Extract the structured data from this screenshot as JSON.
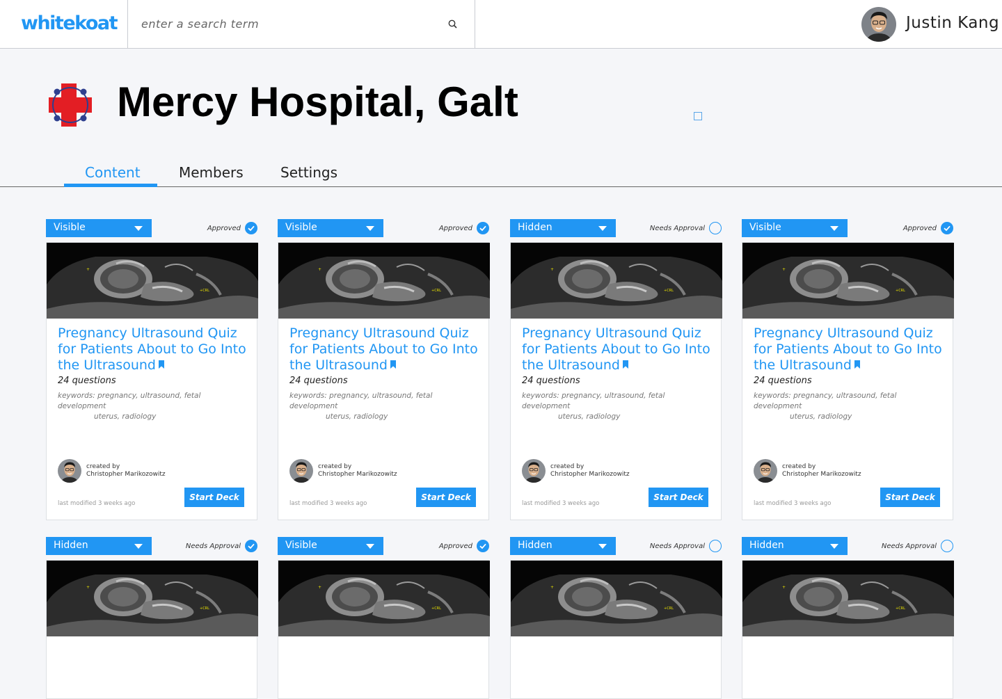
{
  "header": {
    "logo": "whitekoat",
    "search_placeholder": "enter a search term",
    "user_name": "Justin Kang"
  },
  "page": {
    "title": "Mercy Hospital, Galt"
  },
  "tabs": [
    {
      "label": "Content",
      "active": true
    },
    {
      "label": "Members",
      "active": false
    },
    {
      "label": "Settings",
      "active": false
    }
  ],
  "colors": {
    "accent": "#2196f3",
    "hospital_red": "#e31e24",
    "hospital_blue": "#2e3f8f"
  },
  "cards": [
    {
      "visibility": "Visible",
      "status": "Approved",
      "checked": true,
      "title": "Pregnancy Ultrasound Quiz for Patients About to Go Into the Ultrasound",
      "questions": "24 questions",
      "keywords_line1": "keywords: pregnancy, ultrasound, fetal development",
      "keywords_line2": "uterus, radiology",
      "created_label": "created by",
      "creator": "Christopher Marikozowitz",
      "modified": "last modified 3 weeks ago",
      "button": "Start Deck"
    },
    {
      "visibility": "Visible",
      "status": "Approved",
      "checked": true,
      "title": "Pregnancy Ultrasound Quiz for Patients About to Go Into the Ultrasound",
      "questions": "24 questions",
      "keywords_line1": "keywords: pregnancy, ultrasound, fetal development",
      "keywords_line2": "uterus, radiology",
      "created_label": "created by",
      "creator": "Christopher Marikozowitz",
      "modified": "last modified 3 weeks ago",
      "button": "Start Deck"
    },
    {
      "visibility": "Hidden",
      "status": "Needs Approval",
      "checked": false,
      "title": "Pregnancy Ultrasound Quiz for Patients About to Go Into the Ultrasound",
      "questions": "24 questions",
      "keywords_line1": "keywords: pregnancy, ultrasound, fetal development",
      "keywords_line2": "uterus, radiology",
      "created_label": "created by",
      "creator": "Christopher Marikozowitz",
      "modified": "last modified 3 weeks ago",
      "button": "Start Deck"
    },
    {
      "visibility": "Visible",
      "status": "Approved",
      "checked": true,
      "title": "Pregnancy Ultrasound Quiz for Patients About to Go Into the Ultrasound",
      "questions": "24 questions",
      "keywords_line1": "keywords: pregnancy, ultrasound, fetal development",
      "keywords_line2": "uterus, radiology",
      "created_label": "created by",
      "creator": "Christopher Marikozowitz",
      "modified": "last modified 3 weeks ago",
      "button": "Start Deck"
    },
    {
      "visibility": "Hidden",
      "status": "Needs Approval",
      "checked": true
    },
    {
      "visibility": "Visible",
      "status": "Approved",
      "checked": true
    },
    {
      "visibility": "Hidden",
      "status": "Needs Approval",
      "checked": false
    },
    {
      "visibility": "Hidden",
      "status": "Needs Approval",
      "checked": false
    }
  ]
}
